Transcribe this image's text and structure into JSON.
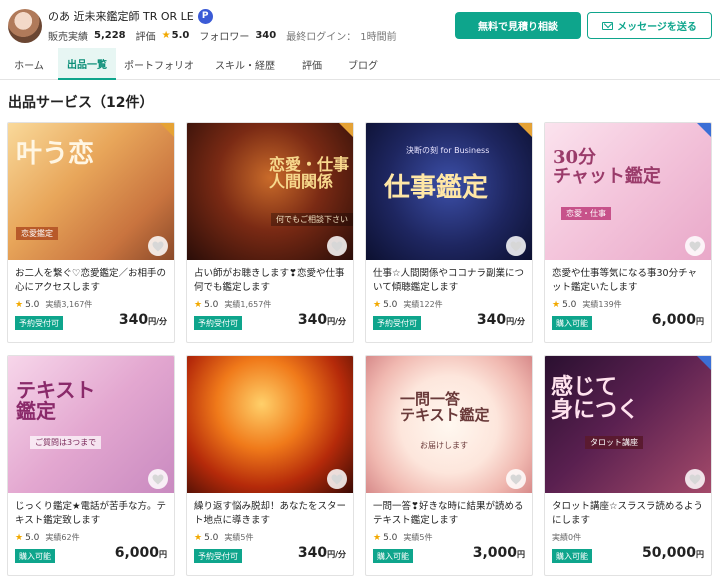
{
  "seller": {
    "name": "のあ 近未来鑑定師 TR OR LE",
    "badge": "P",
    "sales_label": "販売実績",
    "sales_value": "5,228",
    "rating_label": "評価",
    "rating_value": "5.0",
    "follower_label": "フォロワー",
    "follower_value": "340",
    "last_login_label": "最終ログイン：",
    "last_login_value": "1時間前"
  },
  "actions": {
    "quote_label": "無料で見積り相談",
    "message_label": "メッセージを送る"
  },
  "tabs": [
    {
      "label": "ホーム",
      "active": false
    },
    {
      "label": "出品一覧",
      "active": true
    },
    {
      "label": "ポートフォリオ",
      "active": false
    },
    {
      "label": "スキル・経歴",
      "active": false
    },
    {
      "label": "評価",
      "active": false
    },
    {
      "label": "ブログ",
      "active": false
    }
  ],
  "section_title": "出品サービス（12件）",
  "services": [
    {
      "thumb_text": "叶う恋",
      "thumb_sub": "恋愛鑑定",
      "corner": "orange",
      "title": "お二人を繋ぐ♡恋愛鑑定／お相手の心にアクセスします",
      "rating": "5.0",
      "count": "実績3,167件",
      "tag": "予約受付可",
      "price": "340",
      "unit": "円/分"
    },
    {
      "thumb_text": "恋愛・仕事 人間関係",
      "thumb_sub": "何でもご相談下さい",
      "corner": "orange",
      "title": "占い師がお聴きします❣恋愛や仕事何でも鑑定します",
      "rating": "5.0",
      "count": "実績1,657件",
      "tag": "予約受付可",
      "price": "340",
      "unit": "円/分"
    },
    {
      "thumb_text": "仕事鑑定",
      "thumb_sub": "決断の刻 for Business",
      "corner": "orange",
      "title": "仕事☆人間関係やココナラ副業について傾聴鑑定します",
      "rating": "5.0",
      "count": "実績122件",
      "tag": "予約受付可",
      "price": "340",
      "unit": "円/分"
    },
    {
      "thumb_text": "30分 チャット鑑定",
      "thumb_sub": "恋愛・仕事",
      "corner": "blue",
      "title": "恋愛や仕事等気になる事30分チャット鑑定いたします",
      "rating": "5.0",
      "count": "実績139件",
      "tag": "購入可能",
      "price": "6,000",
      "unit": "円"
    },
    {
      "thumb_text": "テキスト 鑑定",
      "thumb_sub": "ご質問は3つまで",
      "corner": "none",
      "title": "じっくり鑑定★電話が苦手な方。テキスト鑑定致します",
      "rating": "5.0",
      "count": "実績62件",
      "tag": "購入可能",
      "price": "6,000",
      "unit": "円"
    },
    {
      "thumb_text": "",
      "thumb_sub": "",
      "corner": "none",
      "title": "繰り返す悩み脱却！あなたをスタート地点に導きます",
      "rating": "5.0",
      "count": "実績5件",
      "tag": "予約受付可",
      "price": "340",
      "unit": "円/分"
    },
    {
      "thumb_text": "一問一答 テキスト鑑定",
      "thumb_sub": "お届けします",
      "corner": "none",
      "title": "一問一答❣好きな時に結果が読めるテキスト鑑定します",
      "rating": "5.0",
      "count": "実績5件",
      "tag": "購入可能",
      "price": "3,000",
      "unit": "円"
    },
    {
      "thumb_text": "感じて 身につく",
      "thumb_sub": "タロット講座",
      "corner": "blue",
      "title": "タロット講座☆スラスラ読めるようにします",
      "rating": "",
      "count": "実績0件",
      "tag": "購入可能",
      "price": "50,000",
      "unit": "円"
    }
  ],
  "colors": {
    "accent": "#0ea58c",
    "star": "#f2a900",
    "corner_orange": "#e5a235",
    "corner_blue": "#3b6fd6"
  }
}
